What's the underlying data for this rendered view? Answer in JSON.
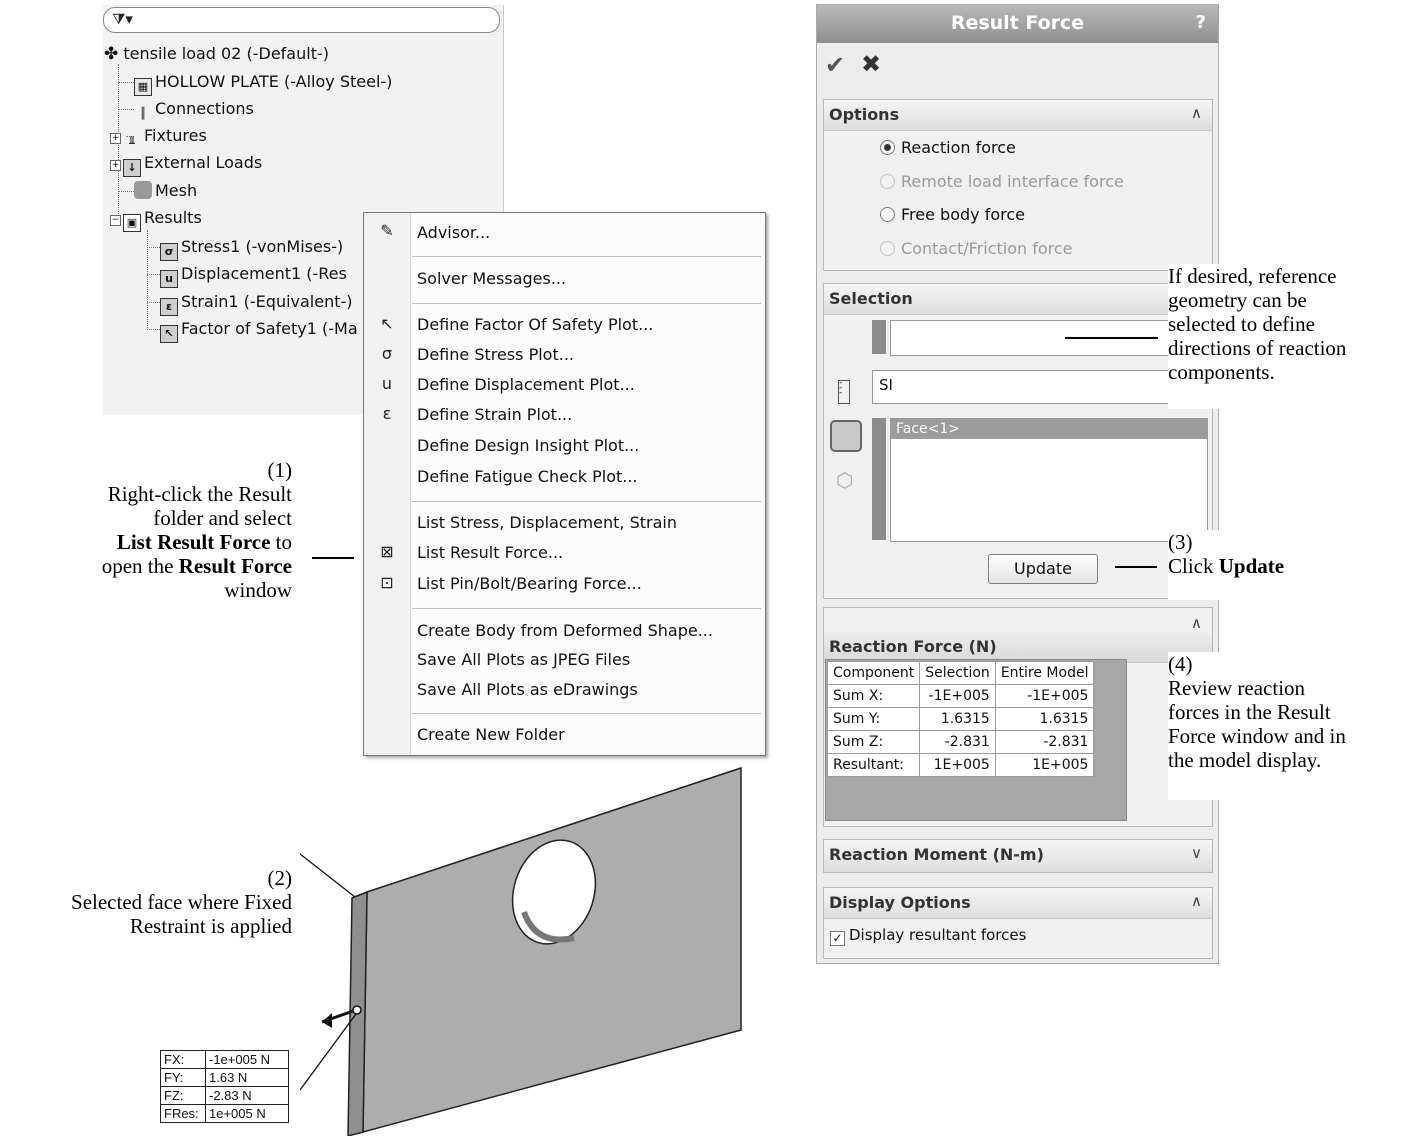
{
  "tree": {
    "filter_icon": "funnel-icon",
    "root": "tensile load 02 (-Default-)",
    "items": [
      {
        "label": "HOLLOW PLATE (-Alloy Steel-)",
        "icon": "part-icon"
      },
      {
        "label": "Connections",
        "icon": "connections-icon"
      },
      {
        "label": "Fixtures",
        "icon": "fixtures-icon"
      },
      {
        "label": "External Loads",
        "icon": "external-loads-icon"
      },
      {
        "label": "Mesh",
        "icon": "mesh-icon"
      },
      {
        "label": "Results",
        "icon": "results-folder-icon"
      }
    ],
    "results": [
      {
        "label": "Stress1 (-vonMises-)",
        "icon": "stress-plot-icon",
        "sym": "σ"
      },
      {
        "label": "Displacement1 (-Res ",
        "icon": "displacement-plot-icon",
        "sym": "u"
      },
      {
        "label": "Strain1 (-Equivalent-)",
        "icon": "strain-plot-icon",
        "sym": "ε"
      },
      {
        "label": "Factor of Safety1 (-Ma",
        "icon": "fos-plot-icon",
        "sym": "↖"
      }
    ]
  },
  "menu": {
    "items": [
      "Advisor...",
      "Solver Messages...",
      "Define Factor Of Safety Plot...",
      "Define Stress Plot...",
      "Define Displacement Plot...",
      "Define Strain Plot...",
      "Define Design Insight Plot...",
      "Define Fatigue Check Plot...",
      "List Stress, Displacement, Strain",
      "List Result Force...",
      "List Pin/Bolt/Bearing Force...",
      "Create Body from Deformed Shape...",
      "Save All Plots as JPEG Files",
      "Save All Plots as eDrawings",
      "Create New Folder"
    ]
  },
  "callouts": {
    "c1": {
      "num": "(1)",
      "l1": "Right-click the Result",
      "l2": "folder and select",
      "l3b": "List Result Force",
      "l3": " to",
      "l4": "open the ",
      "l4b": "Result Force",
      "l5": "window"
    },
    "c2": {
      "num": "(2)",
      "l1": "Selected face where Fixed",
      "l2": "Restraint is applied"
    },
    "c3": {
      "num": "(3)",
      "l1": "Click ",
      "l1b": "Update"
    },
    "c4": {
      "num": "(4)",
      "l1": "Review reaction",
      "l2": "forces in the Result",
      "l3": "Force window and in",
      "l4": "the model display."
    },
    "c5": {
      "l1": "If desired, reference",
      "l2": "geometry can be",
      "l3": "selected to define",
      "l4": "directions of reaction",
      "l5": "components."
    }
  },
  "model": {
    "forces": [
      {
        "k": "FX:",
        "v": "-1e+005 N"
      },
      {
        "k": "FY:",
        "v": "1.63 N"
      },
      {
        "k": "FZ:",
        "v": "-2.83 N"
      },
      {
        "k": "FRes:",
        "v": "1e+005 N"
      }
    ]
  },
  "panel": {
    "title": "Result Force",
    "help": "?",
    "options": {
      "title": "Options",
      "radios": [
        {
          "label": "Reaction force",
          "state": "on"
        },
        {
          "label": "Remote load interface force",
          "state": "disabled"
        },
        {
          "label": "Free body force",
          "state": "off"
        },
        {
          "label": "Contact/Friction force",
          "state": "disabled"
        }
      ]
    },
    "selection": {
      "title": "Selection",
      "units": "SI",
      "face": "Face<1>",
      "update": "Update"
    },
    "reaction_force": {
      "title": "Reaction Force (N)",
      "headers": [
        "Component",
        "Selection",
        "Entire Model"
      ],
      "rows": [
        [
          "Sum X:",
          "-1E+005",
          "-1E+005"
        ],
        [
          "Sum Y:",
          "1.6315",
          "1.6315"
        ],
        [
          "Sum Z:",
          "-2.831",
          "-2.831"
        ],
        [
          "Resultant:",
          "1E+005",
          "1E+005"
        ]
      ]
    },
    "reaction_moment": {
      "title": "Reaction Moment (N-m)"
    },
    "display_options": {
      "title": "Display Options",
      "checkbox": "Display resultant forces",
      "checked": true
    }
  }
}
